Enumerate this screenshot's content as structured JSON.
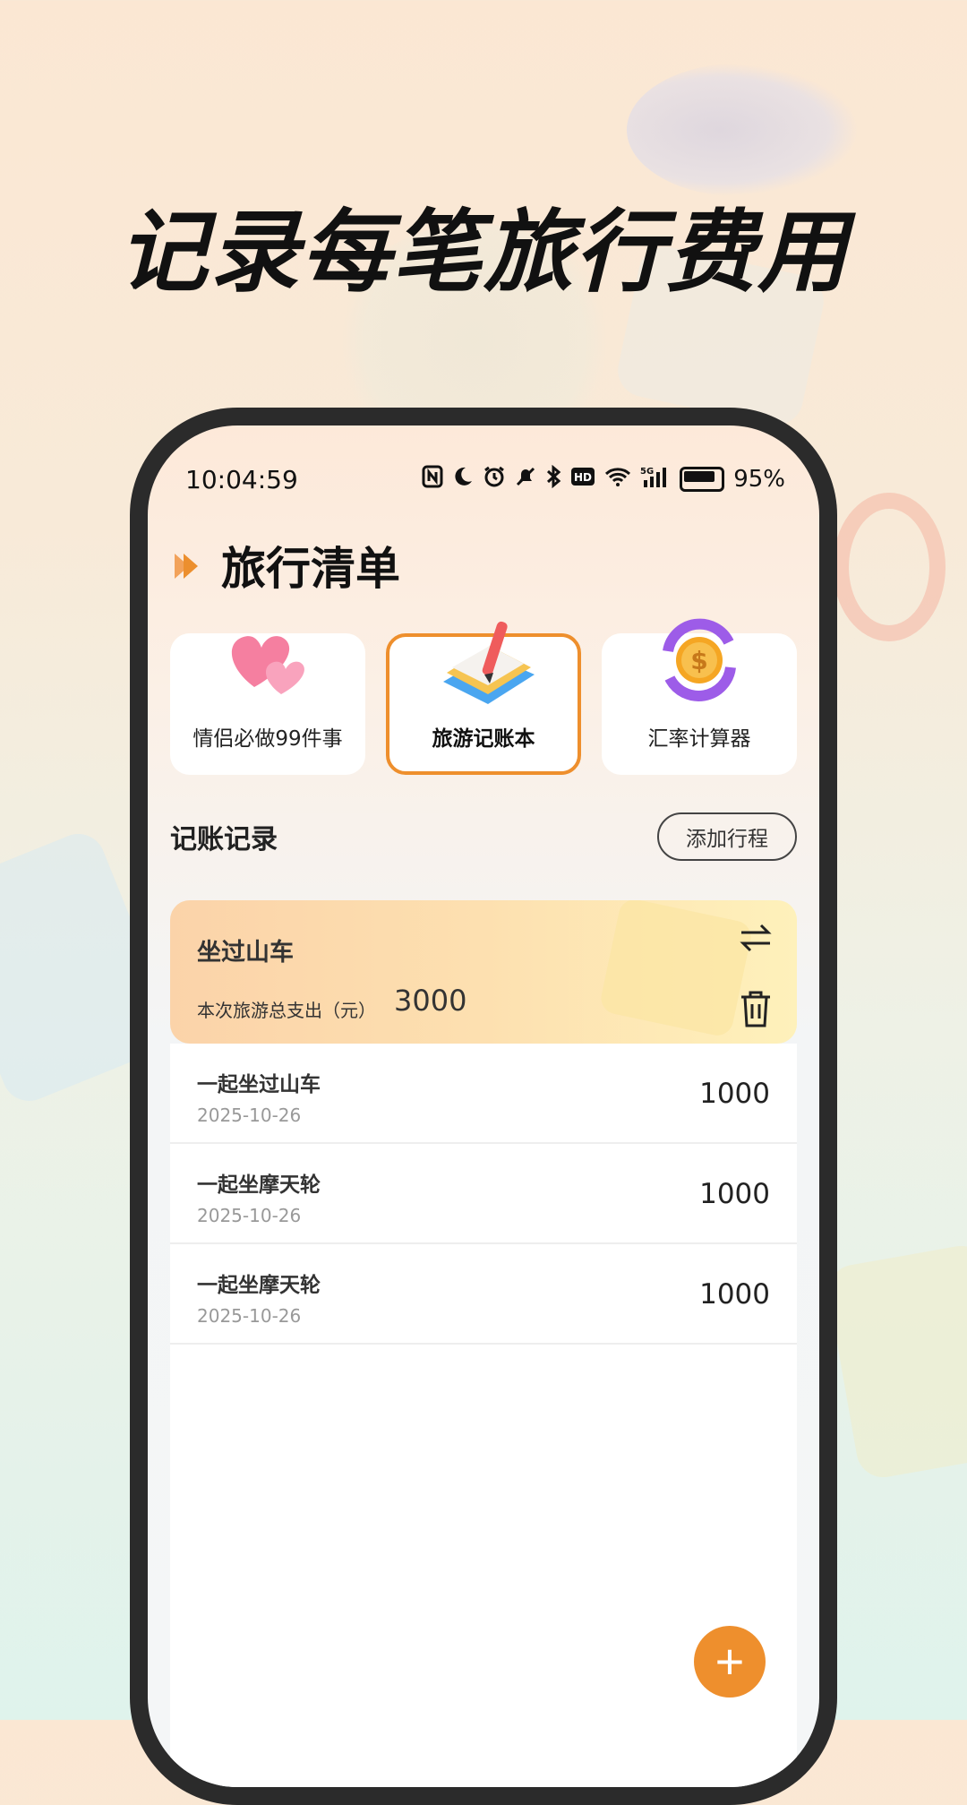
{
  "headline": "记录每笔旅行费用",
  "status_bar": {
    "time": "10:04:59",
    "battery": "95%",
    "signal_label": "5G",
    "hd_label": "HD"
  },
  "page": {
    "title": "旅行清单"
  },
  "feature_cards": [
    {
      "label": "情侣必做99件事",
      "icon": "hearts-icon",
      "active": false
    },
    {
      "label": "旅游记账本",
      "icon": "notebook-pen-icon",
      "active": true
    },
    {
      "label": "汇率计算器",
      "icon": "currency-exchange-icon",
      "active": false
    }
  ],
  "section": {
    "title": "记账记录",
    "add_button": "添加行程"
  },
  "trip": {
    "name": "坐过山车",
    "total_label": "本次旅游总支出（元）",
    "total": "3000"
  },
  "records": [
    {
      "title": "一起坐过山车",
      "date": "2025-10-26",
      "amount": "1000"
    },
    {
      "title": "一起坐摩天轮",
      "date": "2025-10-26",
      "amount": "1000"
    },
    {
      "title": "一起坐摩天轮",
      "date": "2025-10-26",
      "amount": "1000"
    }
  ],
  "fab": {
    "label": "+"
  },
  "colors": {
    "accent": "#ee8f2d",
    "trip_card_start": "#fbd3a9",
    "trip_card_end": "#fef1bb"
  }
}
